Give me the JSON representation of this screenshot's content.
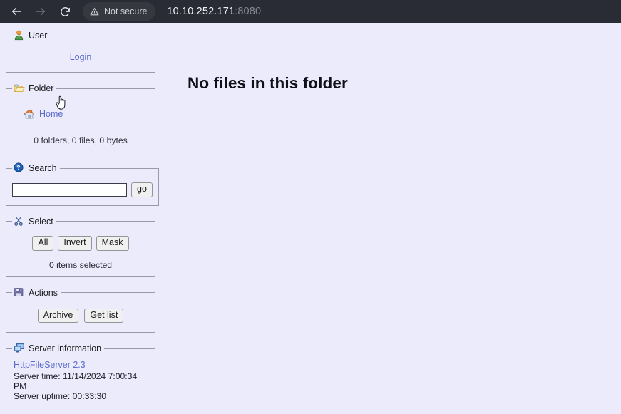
{
  "browser": {
    "back_icon": "back-arrow-icon",
    "forward_icon": "forward-arrow-icon",
    "reload_icon": "reload-icon",
    "security": {
      "icon": "warning-triangle-icon",
      "label": "Not secure"
    },
    "url": {
      "host": "10.10.252.171",
      "port": ":8080"
    }
  },
  "sidebar": {
    "user": {
      "legend": "User",
      "icon": "user-icon",
      "login_label": "Login"
    },
    "folder": {
      "legend": "Folder",
      "icon": "folder-icon",
      "home_label": "Home",
      "home_icon": "home-icon",
      "stats": "0 folders, 0 files, 0 bytes"
    },
    "search": {
      "legend": "Search",
      "icon": "help-icon",
      "value": "",
      "placeholder": "",
      "go_label": "go"
    },
    "select": {
      "legend": "Select",
      "icon": "scissors-icon",
      "buttons": [
        {
          "label": "All"
        },
        {
          "label": "Invert"
        },
        {
          "label": "Mask"
        }
      ],
      "selected_text": "0 items selected"
    },
    "actions": {
      "legend": "Actions",
      "icon": "floppy-save-icon",
      "buttons": [
        {
          "label": "Archive"
        },
        {
          "label": "Get list"
        }
      ]
    },
    "server_information": {
      "legend": "Server information",
      "icon": "server-computer-icon",
      "product_link": "HttpFileServer 2.3",
      "server_time": "Server time: 11/14/2024 7:00:34 PM",
      "server_uptime": "Server uptime: 00:33:30"
    }
  },
  "main": {
    "title": "No files in this folder"
  },
  "cursor": {
    "icon": "pointing-hand-cursor"
  },
  "colors": {
    "page_background": "#ebebfc",
    "chrome_background": "#292c35",
    "link": "#5a6bcd",
    "panel_border": "#9a9aa8"
  }
}
